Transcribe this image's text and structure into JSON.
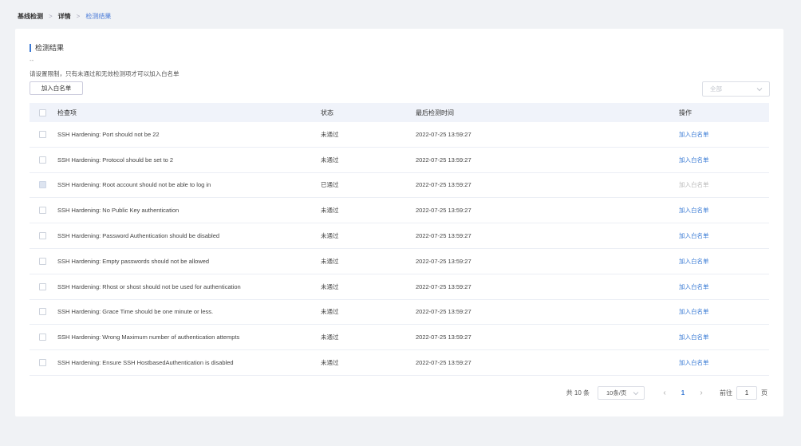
{
  "breadcrumb": [
    {
      "label": "基线检测"
    },
    {
      "label": "详情"
    },
    {
      "label": "检测结果"
    }
  ],
  "section_title": "检测结果",
  "dashes": "--",
  "hint": "请设置限制，只有未通过和无效检测项才可以加入白名单",
  "add_whitelist_button": "加入白名单",
  "filter": {
    "value": "全部"
  },
  "table": {
    "headers": {
      "name": "检查项",
      "status": "状态",
      "time": "最后检测时间",
      "op": "操作"
    },
    "rows": [
      {
        "name": "SSH Hardening: Port should not be 22",
        "status": "未通过",
        "time": "2022-07-25 13:59:27",
        "op": "加入白名单",
        "disabled": false
      },
      {
        "name": "SSH Hardening: Protocol should be set to 2",
        "status": "未通过",
        "time": "2022-07-25 13:59:27",
        "op": "加入白名单",
        "disabled": false
      },
      {
        "name": "SSH Hardening: Root account should not be able to log in",
        "status": "已通过",
        "time": "2022-07-25 13:59:27",
        "op": "加入白名单",
        "disabled": true
      },
      {
        "name": "SSH Hardening: No Public Key authentication",
        "status": "未通过",
        "time": "2022-07-25 13:59:27",
        "op": "加入白名单",
        "disabled": false
      },
      {
        "name": "SSH Hardening: Password Authentication should be disabled",
        "status": "未通过",
        "time": "2022-07-25 13:59:27",
        "op": "加入白名单",
        "disabled": false
      },
      {
        "name": "SSH Hardening: Empty passwords should not be allowed",
        "status": "未通过",
        "time": "2022-07-25 13:59:27",
        "op": "加入白名单",
        "disabled": false
      },
      {
        "name": "SSH Hardening: Rhost or shost should not be used for authentication",
        "status": "未通过",
        "time": "2022-07-25 13:59:27",
        "op": "加入白名单",
        "disabled": false
      },
      {
        "name": "SSH Hardening: Grace Time should be one minute or less.",
        "status": "未通过",
        "time": "2022-07-25 13:59:27",
        "op": "加入白名单",
        "disabled": false
      },
      {
        "name": "SSH Hardening: Wrong Maximum number of authentication attempts",
        "status": "未通过",
        "time": "2022-07-25 13:59:27",
        "op": "加入白名单",
        "disabled": false
      },
      {
        "name": "SSH Hardening: Ensure SSH HostbasedAuthentication is disabled",
        "status": "未通过",
        "time": "2022-07-25 13:59:27",
        "op": "加入白名单",
        "disabled": false
      }
    ]
  },
  "pagination": {
    "total": "共 10 条",
    "page_size": "10条/页",
    "prev_icon": "chevron-left-icon",
    "next_icon": "chevron-right-icon",
    "current_page": "1",
    "goto_label": "前往",
    "goto_value": "1",
    "page_suffix": "页"
  },
  "colors": {
    "accent": "#3a7bd5",
    "background": "#f0f2f5",
    "header_bg": "#f0f3fa"
  }
}
